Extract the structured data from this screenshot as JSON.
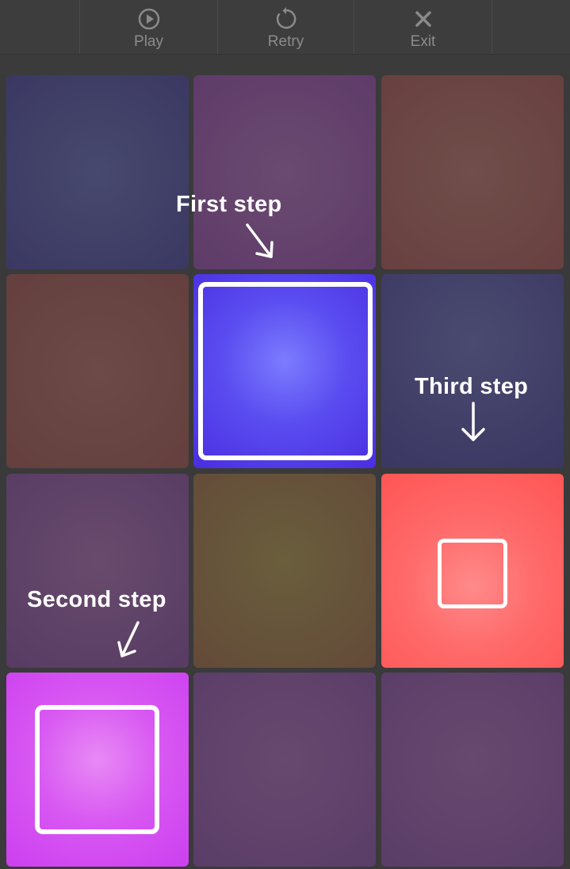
{
  "toolbar": {
    "play_label": "Play",
    "retry_label": "Retry",
    "exit_label": "Exit",
    "icons": [
      "play-icon",
      "retry-icon",
      "close-icon"
    ]
  },
  "board": {
    "rows": 4,
    "cols": 3,
    "tiles": [
      {
        "row": 1,
        "col": 1,
        "color": "#3e3b66",
        "state": "dim"
      },
      {
        "row": 1,
        "col": 2,
        "color": "#5f3e6a",
        "state": "dim"
      },
      {
        "row": 1,
        "col": 3,
        "color": "#6a423f",
        "state": "dim"
      },
      {
        "row": 2,
        "col": 1,
        "color": "#6a423f",
        "state": "dim"
      },
      {
        "row": 2,
        "col": 2,
        "color": "#4a2ee0",
        "state": "active"
      },
      {
        "row": 2,
        "col": 3,
        "color": "#3e3b66",
        "state": "dim"
      },
      {
        "row": 3,
        "col": 1,
        "color": "#5a3d66",
        "state": "dim"
      },
      {
        "row": 3,
        "col": 2,
        "color": "#61483a",
        "state": "dim"
      },
      {
        "row": 3,
        "col": 3,
        "color": "#ff5a5a",
        "state": "active"
      },
      {
        "row": 4,
        "col": 1,
        "color": "#cf44f0",
        "state": "active"
      },
      {
        "row": 4,
        "col": 2,
        "color": "#5a3d6a",
        "state": "dim"
      },
      {
        "row": 4,
        "col": 3,
        "color": "#5a3d6a",
        "state": "dim"
      }
    ]
  },
  "annotations": {
    "first": "First step",
    "second": "Second step",
    "third": "Third step"
  }
}
